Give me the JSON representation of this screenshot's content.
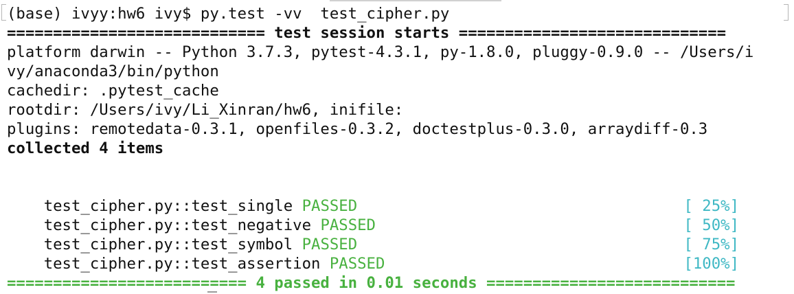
{
  "terminal": {
    "prompt_line": "(base) ivyy:hw6 ivy$ py.test -vv  test_cipher.py",
    "session_start": "============================ test session starts =============================",
    "platform_line1": "platform darwin -- Python 3.7.3, pytest-4.3.1, py-1.8.0, pluggy-0.9.0 -- /Users/i",
    "platform_line2": "vy/anaconda3/bin/python",
    "cachedir": "cachedir: .pytest_cache",
    "rootdir": "rootdir: /Users/ivy/Li_Xinran/hw6, inifile:",
    "plugins": "plugins: remotedata-0.3.1, openfiles-0.3.2, doctestplus-0.3.0, arraydiff-0.3",
    "collected": "collected 4 items",
    "tests": [
      {
        "name": "test_cipher.py::test_single",
        "status": "PASSED",
        "progress": "[ 25%]"
      },
      {
        "name": "test_cipher.py::test_negative",
        "status": "PASSED",
        "progress": "[ 50%]"
      },
      {
        "name": "test_cipher.py::test_symbol",
        "status": "PASSED",
        "progress": "[ 75%]"
      },
      {
        "name": "test_cipher.py::test_assertion",
        "status": "PASSED",
        "progress": "[100%]"
      }
    ],
    "summary": "========================== 4 passed in 0.01 seconds ==========================="
  },
  "colors": {
    "passed": "#48b13f",
    "progress": "#3fb8c4",
    "text": "#111111",
    "background": "#ffffff"
  }
}
